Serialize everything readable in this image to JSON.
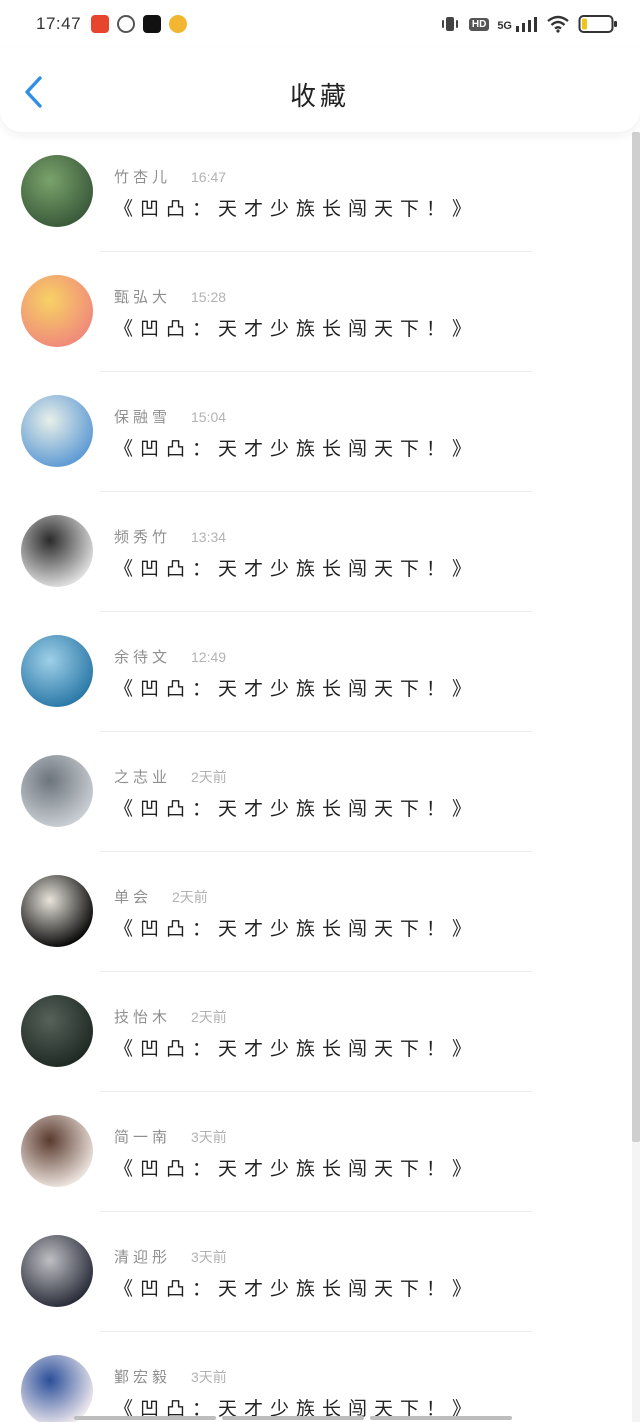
{
  "status_bar": {
    "time": "17:47",
    "network": "5G",
    "hd": "HD",
    "battery_level": 0.15
  },
  "header": {
    "title": "收藏"
  },
  "items": [
    {
      "name": "竹杏儿",
      "time": "16:47",
      "text": "《凹凸：天才少族长闯天下！》",
      "avatar_colors": [
        "#3b5a3b",
        "#7aa36b"
      ]
    },
    {
      "name": "甄弘大",
      "time": "15:28",
      "text": "《凹凸：天才少族长闯天下！》",
      "avatar_colors": [
        "#f08a7a",
        "#f7d264"
      ]
    },
    {
      "name": "保融雪",
      "time": "15:04",
      "text": "《凹凸：天才少族长闯天下！》",
      "avatar_colors": [
        "#5f9bd4",
        "#e8efe8"
      ]
    },
    {
      "name": "频秀竹",
      "time": "13:34",
      "text": "《凹凸：天才少族长闯天下！》",
      "avatar_colors": [
        "#dedede",
        "#2b2b2b"
      ]
    },
    {
      "name": "余待文",
      "time": "12:49",
      "text": "《凹凸：天才少族长闯天下！》",
      "avatar_colors": [
        "#2c79a8",
        "#9fd0e8"
      ]
    },
    {
      "name": "之志业",
      "time": "2天前",
      "text": "《凹凸：天才少族长闯天下！》",
      "avatar_colors": [
        "#c9ced3",
        "#6c747c"
      ]
    },
    {
      "name": "单会",
      "time": "2天前",
      "text": "《凹凸：天才少族长闯天下！》",
      "avatar_colors": [
        "#0b0b0b",
        "#e8e4dc"
      ]
    },
    {
      "name": "技怡木",
      "time": "2天前",
      "text": "《凹凸：天才少族长闯天下！》",
      "avatar_colors": [
        "#1f2a24",
        "#56625a"
      ]
    },
    {
      "name": "简一南",
      "time": "3天前",
      "text": "《凹凸：天才少族长闯天下！》",
      "avatar_colors": [
        "#ece3dd",
        "#5a3a2e"
      ]
    },
    {
      "name": "清迎彤",
      "time": "3天前",
      "text": "《凹凸：天才少族长闯天下！》",
      "avatar_colors": [
        "#2a2d3a",
        "#bfbfc4"
      ]
    },
    {
      "name": "鄞宏毅",
      "time": "3天前",
      "text": "《凹凸：天才少族长闯天下！》",
      "avatar_colors": [
        "#efe9ee",
        "#2a4f9a"
      ]
    }
  ]
}
